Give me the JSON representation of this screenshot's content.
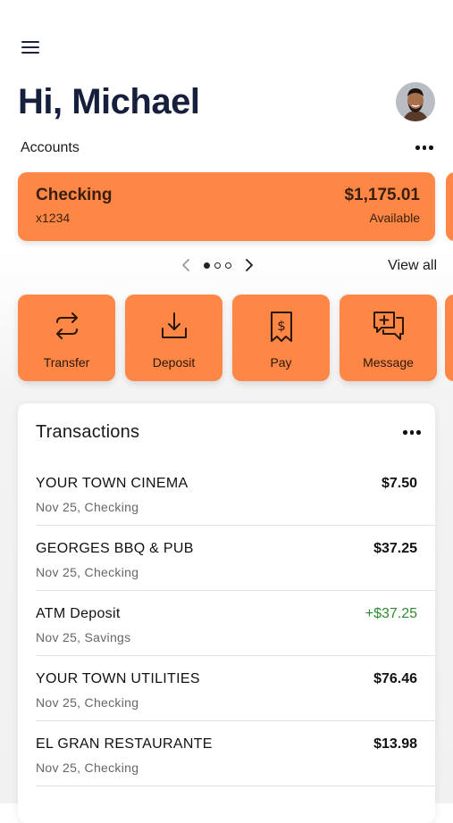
{
  "header": {
    "greeting": "Hi, Michael"
  },
  "accounts": {
    "label": "Accounts",
    "card": {
      "name": "Checking",
      "number": "x1234",
      "balance": "$1,175.01",
      "balance_label": "Available"
    },
    "pager": {
      "total": 3,
      "active": 1
    },
    "view_all": "View all"
  },
  "actions": [
    {
      "label": "Transfer",
      "icon": "transfer-icon"
    },
    {
      "label": "Deposit",
      "icon": "deposit-icon"
    },
    {
      "label": "Pay",
      "icon": "pay-icon"
    },
    {
      "label": "Message",
      "icon": "message-icon"
    }
  ],
  "transactions": {
    "title": "Transactions",
    "items": [
      {
        "merchant": "YOUR TOWN CINEMA",
        "detail": "Nov 25, Checking",
        "amount": "$7.50"
      },
      {
        "merchant": "GEORGES BBQ & PUB",
        "detail": "Nov 25, Checking",
        "amount": "$37.25"
      },
      {
        "merchant": "ATM Deposit",
        "detail": "Nov 25, Savings",
        "amount": "+$37.25"
      },
      {
        "merchant": "YOUR TOWN UTILITIES",
        "detail": "Nov 25, Checking",
        "amount": "$76.46"
      },
      {
        "merchant": "EL GRAN RESTAURANTE",
        "detail": "Nov 25, Checking",
        "amount": "$13.98"
      }
    ]
  },
  "colors": {
    "accent": "#ff8745",
    "heading": "#16203d",
    "credit": "#2e8b2e"
  }
}
